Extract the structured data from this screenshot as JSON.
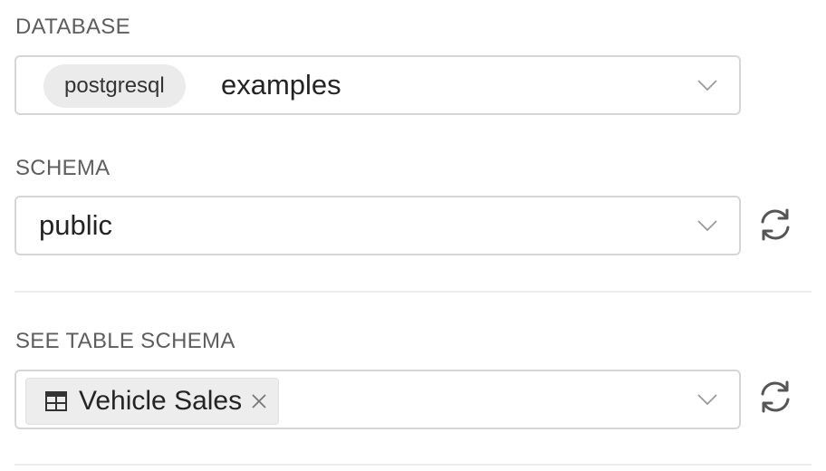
{
  "database": {
    "label": "DATABASE",
    "engine_badge": "postgresql",
    "selected": "examples"
  },
  "schema": {
    "label": "SCHEMA",
    "selected": "public"
  },
  "table_schema": {
    "label": "SEE TABLE SCHEMA",
    "selected_tag": "Vehicle Sales"
  },
  "icons": {
    "dropdown": "chevron-down-icon",
    "refresh": "refresh-icon",
    "table": "table-icon",
    "remove": "close-icon"
  },
  "colors": {
    "border": "#d6d6d6",
    "label_text": "#5e5e5e",
    "pill_bg": "#ebebeb",
    "icon": "#555555"
  }
}
